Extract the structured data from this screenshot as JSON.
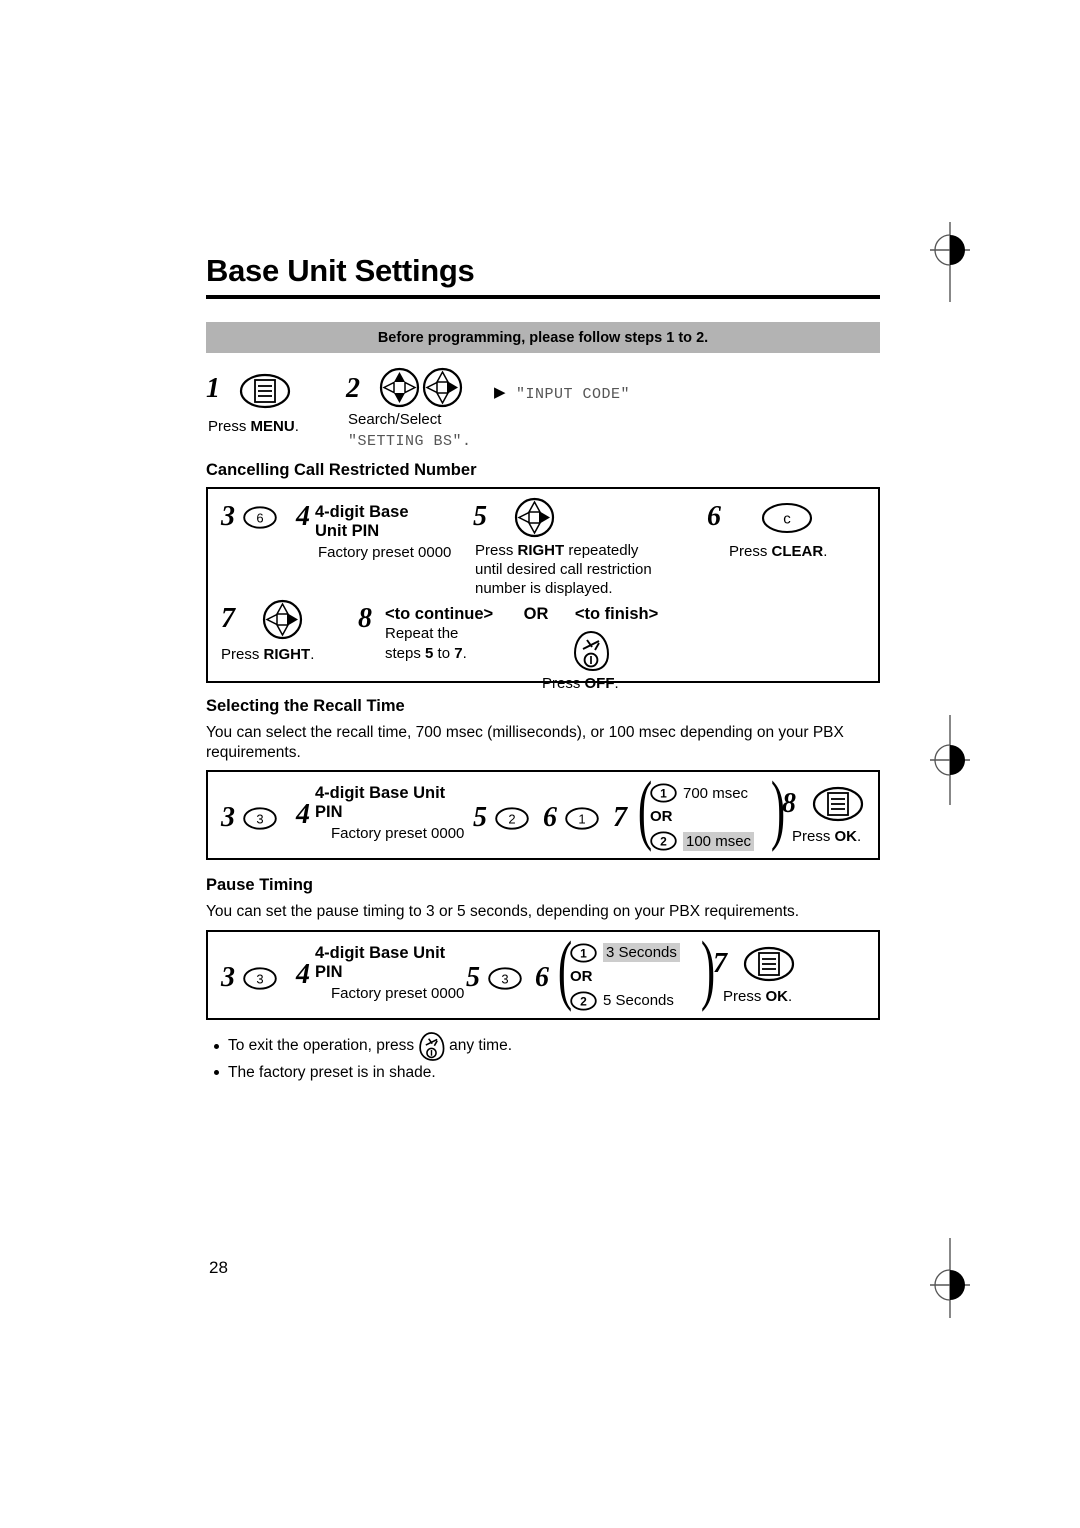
{
  "document": {
    "title": "Base Unit Settings",
    "page_number": "28",
    "banner": "Before programming, please follow steps 1 to 2."
  },
  "intro_steps": {
    "step1": {
      "number": "1",
      "icon": "menu-key-icon",
      "caption_prefix": "Press ",
      "caption_bold": "MENU",
      "caption_suffix": "."
    },
    "step2": {
      "number": "2",
      "icon_a": "nav-key-updown-icon",
      "icon_b": "nav-key-right-icon",
      "caption_line1": "Search/Select",
      "caption_line2": "\"SETTING BS\"."
    },
    "display": {
      "arrow": "▶",
      "text": "\"INPUT CODE\""
    }
  },
  "sections": [
    {
      "heading": "Cancelling Call Restricted Number",
      "steps": {
        "s3": {
          "number": "3",
          "key": "6"
        },
        "s4": {
          "number": "4",
          "title_line1": "4-digit Base",
          "title_line2": "Unit PIN",
          "note": "Factory preset 0000"
        },
        "s5": {
          "number": "5",
          "icon": "nav-key-right-icon",
          "text_line1_a": "Press ",
          "text_line1_b": "RIGHT",
          "text_line1_c": " repeatedly",
          "text_line2": "until desired call restriction",
          "text_line3": "number is displayed."
        },
        "s6": {
          "number": "6",
          "key_label": "c",
          "caption_prefix": "Press ",
          "caption_bold": "CLEAR",
          "caption_suffix": "."
        },
        "s7": {
          "number": "7",
          "icon": "nav-key-right-icon",
          "caption_prefix": "Press ",
          "caption_bold": "RIGHT",
          "caption_suffix": "."
        },
        "s8": {
          "number": "8",
          "continue_label": "<to continue>",
          "continue_line1": "Repeat the",
          "continue_line2_a": "steps ",
          "continue_line2_b": "5",
          "continue_line2_c": " to ",
          "continue_line2_d": "7",
          "continue_line2_e": ".",
          "or_label": "OR",
          "finish_label": "<to finish>",
          "finish_icon": "off-key-icon",
          "finish_caption_prefix": "Press ",
          "finish_caption_bold": "OFF",
          "finish_caption_suffix": "."
        }
      }
    },
    {
      "heading": "Selecting the Recall Time",
      "body": "You can select the recall time, 700 msec (milliseconds), or 100 msec depending on your PBX requirements.",
      "steps": {
        "s3": {
          "number": "3",
          "key": "3"
        },
        "s4": {
          "number": "4",
          "title_line1": "4-digit Base Unit",
          "title_line2": "PIN",
          "note": "Factory preset 0000"
        },
        "s5": {
          "number": "5",
          "key": "2"
        },
        "s6": {
          "number": "6",
          "key": "1"
        },
        "s7": {
          "number": "7",
          "option1_key": "1",
          "option1_label": "700 msec",
          "or_label": "OR",
          "option2_key": "2",
          "option2_label": "100 msec",
          "option2_shaded": true
        },
        "s8": {
          "number": "8",
          "icon": "menu-key-icon",
          "caption_prefix": "Press ",
          "caption_bold": "OK",
          "caption_suffix": "."
        }
      }
    },
    {
      "heading": "Pause Timing",
      "body": "You can set the pause timing to 3 or 5 seconds, depending on your PBX requirements.",
      "steps": {
        "s3": {
          "number": "3",
          "key": "3"
        },
        "s4": {
          "number": "4",
          "title_line1": "4-digit Base Unit",
          "title_line2": "PIN",
          "note": "Factory preset 0000"
        },
        "s5": {
          "number": "5",
          "key": "3"
        },
        "s6": {
          "number": "6",
          "option1_key": "1",
          "option1_label": "3 Seconds",
          "option1_shaded": true,
          "or_label": "OR",
          "option2_key": "2",
          "option2_label": "5 Seconds"
        },
        "s7": {
          "number": "7",
          "icon": "menu-key-icon",
          "caption_prefix": "Press ",
          "caption_bold": "OK",
          "caption_suffix": "."
        }
      }
    }
  ],
  "notes": [
    {
      "text_a": "To exit the operation, press ",
      "icon": "off-key-icon",
      "text_b": " any time."
    },
    {
      "text_a": "The factory preset is in shade.",
      "icon": null,
      "text_b": ""
    }
  ],
  "colors": {
    "banner_gray": "#b3b3b3",
    "shade_gray": "#cccccc",
    "ink": "#000000",
    "lcd_text": "#555555"
  }
}
